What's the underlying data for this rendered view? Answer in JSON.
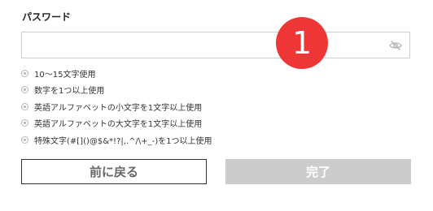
{
  "form": {
    "password_label": "パスワード",
    "password_value": "",
    "password_placeholder": "",
    "toggle_icon": "eye-slash-icon"
  },
  "badge": {
    "text": "1",
    "color": "#ee3636"
  },
  "rules": [
    {
      "text": "10～15文字使用"
    },
    {
      "text": "数字を1つ以上使用"
    },
    {
      "text": "英語アルファベットの小文字を1文字以上使用"
    },
    {
      "text": "英語アルファベットの大文字を1文字以上使用"
    },
    {
      "text": "特殊文字(#[]()@$&*!?|,.^/\\+_-)を1つ以上使用"
    }
  ],
  "buttons": {
    "back_label": "前に戻る",
    "finish_label": "完了"
  },
  "colors": {
    "finish_button_disabled": "#cccccc",
    "back_button_border": "#333333",
    "rule_icon": "#b5b5b5"
  }
}
